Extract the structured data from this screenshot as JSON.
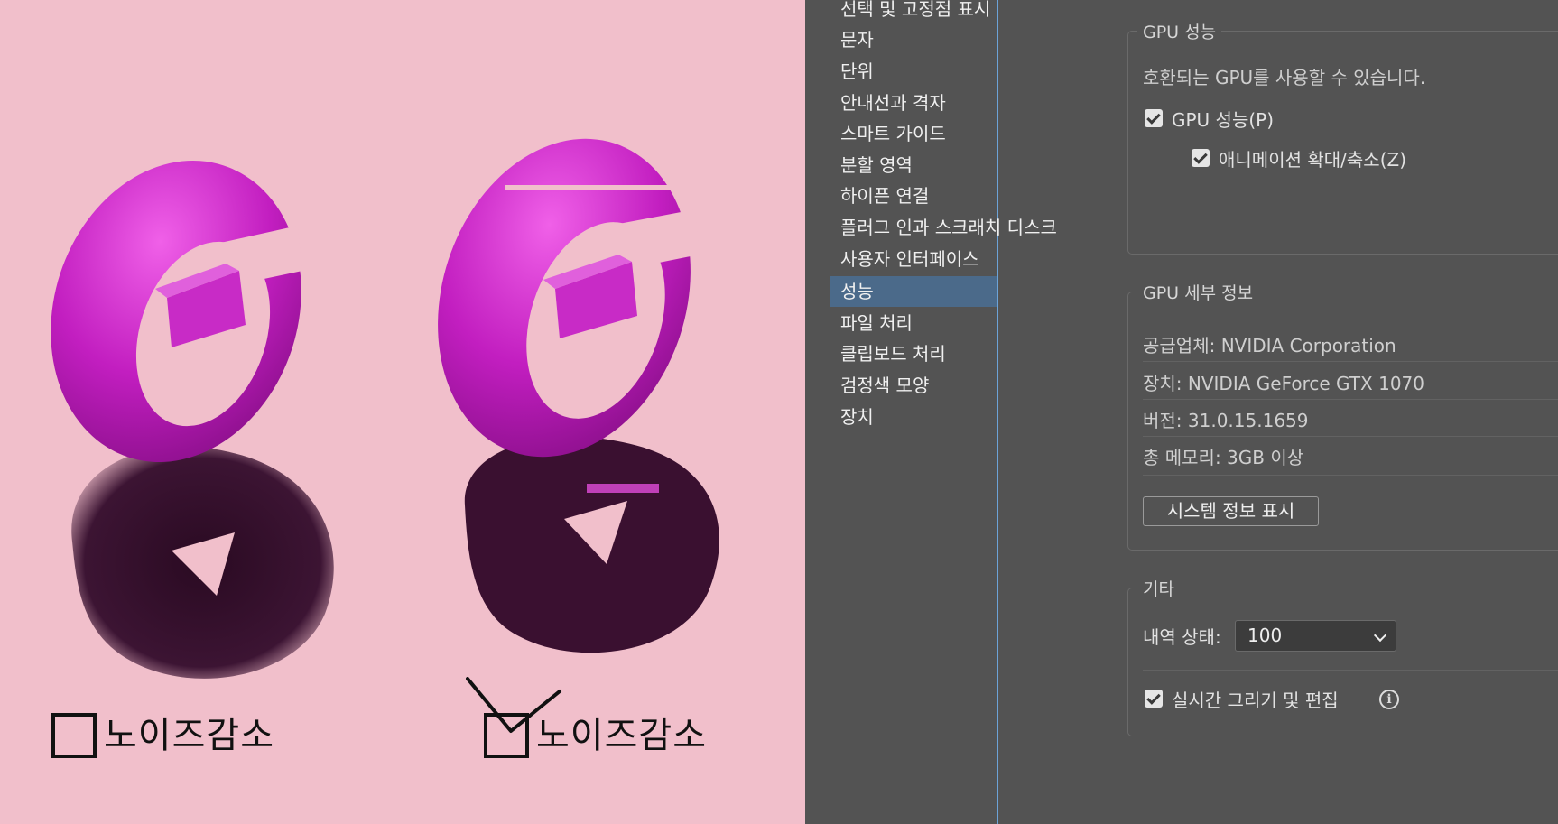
{
  "artwork": {
    "caption_left": "노이즈감소",
    "caption_right": "노이즈감소",
    "background_color": "#f1bfcb",
    "object_color": "#d62ad0"
  },
  "categories": {
    "items": [
      "선택 및 고정점 표시",
      "문자",
      "단위",
      "안내선과 격자",
      "스마트 가이드",
      "분할 영역",
      "하이픈 연결",
      "플러그 인과 스크래치 디스크",
      "사용자 인터페이스",
      "성능",
      "파일 처리",
      "클립보드 처리",
      "검정색 모양",
      "장치"
    ],
    "selected": "성능"
  },
  "gpu_performance": {
    "title": "GPU 성능",
    "description": "호환되는 GPU를 사용할 수 있습니다.",
    "gpu_checkbox_label": "GPU 성능(P)",
    "gpu_checked": true,
    "animation_checkbox_label": "애니메이션 확대/축소(Z)",
    "animation_checked": true
  },
  "gpu_details": {
    "title": "GPU 세부 정보",
    "vendor": "공급업체: NVIDIA Corporation",
    "device": "장치: NVIDIA GeForce GTX 1070",
    "version": "버전: 31.0.15.1659",
    "memory": "총 메모리:  3GB 이상",
    "system_info_button": "시스템 정보 표시"
  },
  "other": {
    "title": "기타",
    "history_label": "내역 상태:",
    "history_value": "100",
    "realtime_label": "실시간 그리기 및 편집",
    "realtime_checked": true,
    "info_icon": "info-icon"
  },
  "colors": {
    "panel_bg": "#535353",
    "selection": "#4b6a8a",
    "accent_border": "#6ca3d8"
  }
}
